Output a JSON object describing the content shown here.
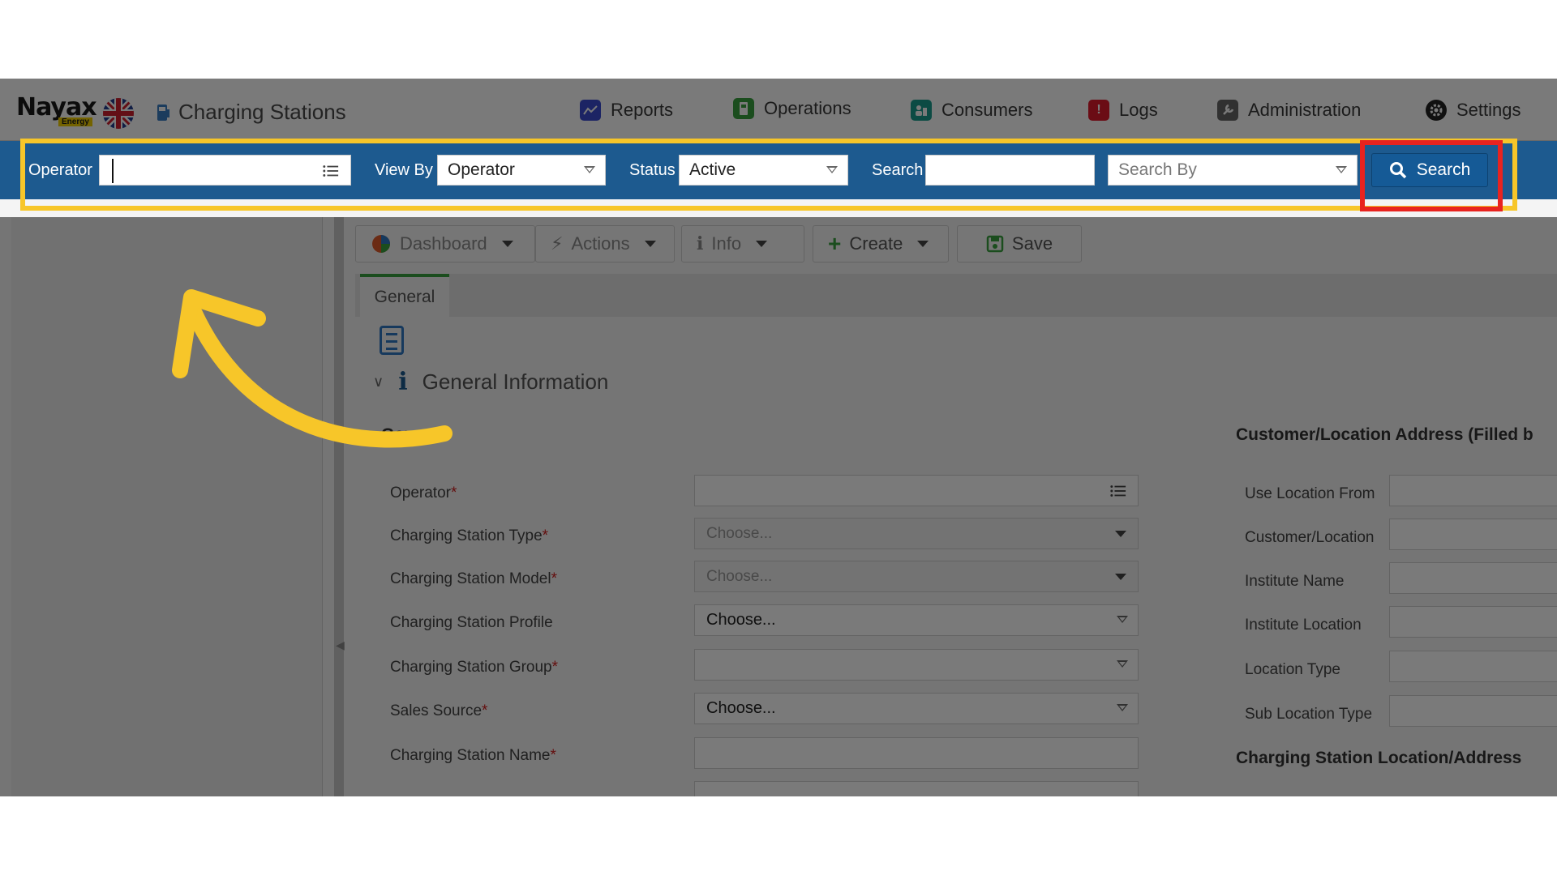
{
  "app": {
    "brand": "Nayax",
    "brand_sub": "Energy",
    "title": "Charging Stations"
  },
  "nav": [
    {
      "label": "Reports",
      "icon": "chart-icon",
      "color": "#3b4bd1"
    },
    {
      "label": "Operations",
      "icon": "operations-icon",
      "color": "#3aa23f"
    },
    {
      "label": "Consumers",
      "icon": "consumers-icon",
      "color": "#1a9e8f"
    },
    {
      "label": "Logs",
      "icon": "alert-icon",
      "color": "#e0192d"
    },
    {
      "label": "Administration",
      "icon": "admin-icon",
      "color": "#666666"
    },
    {
      "label": "Settings",
      "icon": "gear-icon",
      "color": "#222222"
    }
  ],
  "filters": {
    "operator_label": "Operator",
    "operator_value": "",
    "viewby_label": "View By",
    "viewby_value": "Operator",
    "status_label": "Status",
    "status_value": "Active",
    "search_label": "Search",
    "search_value": "",
    "searchby_placeholder": "Search By",
    "search_button": "Search"
  },
  "toolbar": {
    "dashboard": "Dashboard",
    "actions": "Actions",
    "info": "Info",
    "create": "Create",
    "save": "Save"
  },
  "tabs": {
    "general": "General"
  },
  "section": {
    "title": "General Information"
  },
  "general_group": {
    "title": "General",
    "fields": [
      {
        "label": "Operator",
        "required": "*",
        "value": ""
      },
      {
        "label": "Charging Station Type",
        "required": "*",
        "value": "Choose..."
      },
      {
        "label": "Charging Station Model",
        "required": "*",
        "value": "Choose..."
      },
      {
        "label": "Charging Station Profile",
        "required": "",
        "value": "Choose..."
      },
      {
        "label": "Charging Station Group",
        "required": "*",
        "value": ""
      },
      {
        "label": "Sales Source",
        "required": "*",
        "value": "Choose..."
      },
      {
        "label": "Charging Station Name",
        "required": "*",
        "value": ""
      }
    ]
  },
  "address_group": {
    "title": "Customer/Location Address (Filled b",
    "fields": [
      "Use Location From",
      "Customer/Location",
      "Institute Name",
      "Institute Location",
      "Location Type",
      "Sub Location Type"
    ],
    "location_title": "Charging Station Location/Address"
  },
  "annotation": {
    "arrow_color": "#f7c629",
    "highlight_color": "#f7c629",
    "button_highlight_color": "#e8231f"
  }
}
